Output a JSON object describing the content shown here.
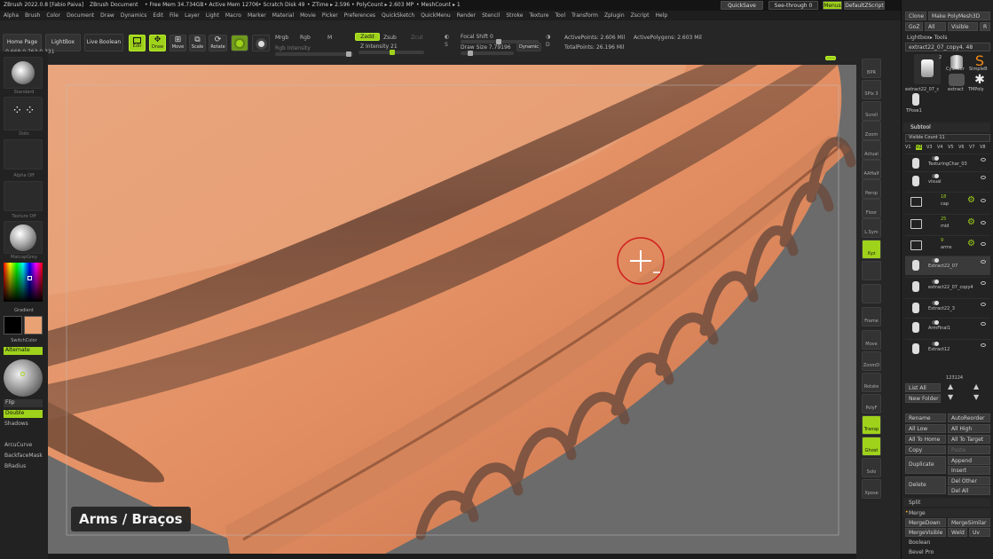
{
  "title": {
    "app": "ZBrush 2022.0.8 [Fabio Paiva]",
    "doc": "ZBrush Document",
    "free_mem": "• Free Mem 34.734GB",
    "active_mem": "• Active Mem 12706",
    "scratch": "• Scratch Disk 49",
    "ztime": "• ZTime ▸ 2.596",
    "polycount": "• PolyCount ▸ 2.603 MP",
    "meshcount": "• MeshCount ▸ 1"
  },
  "topright": {
    "quicksave": "QuickSave",
    "seethrough": "See-through  0",
    "menus": "Menus",
    "script": "DefaultZScript"
  },
  "menus": [
    "Alpha",
    "Brush",
    "Color",
    "Document",
    "Draw",
    "Dynamics",
    "Edit",
    "File",
    "Layer",
    "Light",
    "Macro",
    "Marker",
    "Material",
    "Movie",
    "Picker",
    "Preferences",
    "QuickSketch",
    "QuickMenu",
    "Render",
    "Stencil",
    "Stroke",
    "Texture",
    "Tool",
    "Transform",
    "Zplugin",
    "Zscript",
    "Help"
  ],
  "toolbar": {
    "home": "Home Page",
    "lightbox": "LightBox",
    "live_boolean": "Live Boolean",
    "edit": "Edit",
    "draw": "Draw",
    "move": "Move",
    "scale": "Scale",
    "rotate": "Rotate",
    "mrgb": "Mrgb",
    "rgb": "Rgb",
    "m": "M",
    "rgb_intensity": "Rgb Intensity",
    "zadd": "Zadd",
    "zsub": "Zsub",
    "zcut": "Zcut",
    "z_intensity": "Z Intensity 21",
    "focal_shift": "Focal Shift 0",
    "draw_size": "Draw Size 7.79196",
    "dynamic": "Dynamic",
    "active_points": "ActivePoints: 2.606 Mil",
    "total_points": "TotalPoints: 26.196 Mil",
    "active_polygons": "ActivePolygons: 2.603 Mil",
    "coords": "-0.668,0.763,0.331",
    "s_key": "S",
    "d_key": "D"
  },
  "leftshelf": {
    "standard": "Standard",
    "dots": "Dots",
    "alpha_off": "Alpha Off",
    "texture_off": "Texture Off",
    "matcap": "MatcapGrey",
    "gradient": "Gradient",
    "switch_color": "SwitchColor",
    "alternate": "Alternate",
    "flip": "Flip",
    "double": "Double",
    "shadows": "Shadows",
    "arcucurve": "ArcuCurve",
    "backface": "BackfaceMask",
    "bradius": "BRadius",
    "main_color": "#000000",
    "secondary_color": "#e9a273"
  },
  "rightshelf": [
    "BPR",
    "SPix 3",
    "Scroll",
    "Zoom",
    "Actual",
    "AAHalf",
    "Persp",
    "Floor",
    "L.Sym",
    "Xyz",
    "",
    "",
    "Frame",
    "Move",
    "ZoomD",
    "Rotate",
    "PolyF",
    "Transp",
    "Ghost",
    "Solo",
    "Xpose"
  ],
  "panel": {
    "clone": "Clone",
    "make_polymesh": "Make PolyMesh3D",
    "goz": "GoZ",
    "all": "All",
    "visible": "Visible",
    "r": "R",
    "lightbox_tools": "Lightbox▸ Tools",
    "current_tool": "extract22_07_copy4. 48",
    "tool_count": "2",
    "cylinder_label": "Cylinder",
    "simple_label": "SimpleB",
    "extract_label1": "extract22_07_c",
    "extract_label2": "extract",
    "tmpoly": "TMPoly",
    "tpose": "TPose1",
    "subtool": "Subtool",
    "visible_count": "Visible Count 11",
    "v_tabs": [
      "V1",
      "V2",
      "V3",
      "V4",
      "V5",
      "V6",
      "V7",
      "V8"
    ],
    "subtools": [
      {
        "name": "TexturingChar_03",
        "count": ""
      },
      {
        "name": "visual",
        "count": ""
      },
      {
        "name": "cap",
        "count": "18"
      },
      {
        "name": "mid",
        "count": "25"
      },
      {
        "name": "arms",
        "count": "9"
      },
      {
        "name": "Extract22_07",
        "count": ""
      },
      {
        "name": "extract22_07_copy4",
        "count": ""
      },
      {
        "name": "Extract22_3",
        "count": ""
      },
      {
        "name": "ArmFinal1",
        "count": ""
      },
      {
        "name": "Extract12",
        "count": ""
      }
    ],
    "sub_number": "123124",
    "list_all": "List All",
    "new_folder": "New Folder",
    "rename": "Rename",
    "autoreorder": "AutoReorder",
    "all_low": "All Low",
    "all_high": "All High",
    "all_to_home": "All To Home",
    "all_to_target": "All To Target",
    "copy": "Copy",
    "paste": "Paste",
    "duplicate": "Duplicate",
    "append": "Append",
    "insert": "Insert",
    "delete": "Delete",
    "del_other": "Del Other",
    "del_all": "Del All",
    "split": "Split",
    "merge": "Merge",
    "mergedown": "MergeDown",
    "mergesimilar": "MergeSimilar",
    "mergevisible": "MergeVisible",
    "weld": "Weld",
    "uv": "Uv",
    "boolean": "Boolean",
    "bevel": "Bevel Pro"
  },
  "caption": "Arms / Braços"
}
